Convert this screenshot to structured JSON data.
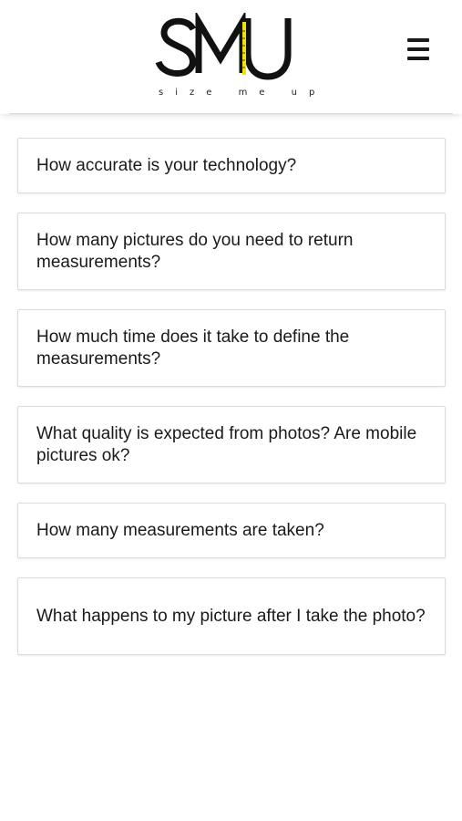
{
  "header": {
    "logo": {
      "letters": "SMU",
      "tagline": "size me up",
      "accent_color": "#f2e600"
    },
    "menu_icon": "hamburger-menu-icon"
  },
  "faq": {
    "items": [
      {
        "question": "How accurate is your technology?"
      },
      {
        "question": "How many pictures do you need to return measurements?"
      },
      {
        "question": "How much time does it take to define the measurements?"
      },
      {
        "question": "What quality is expected from photos? Are mobile pictures ok?"
      },
      {
        "question": "How many measurements are taken?"
      },
      {
        "question": "What happens to my picture after I take the photo?"
      }
    ]
  }
}
